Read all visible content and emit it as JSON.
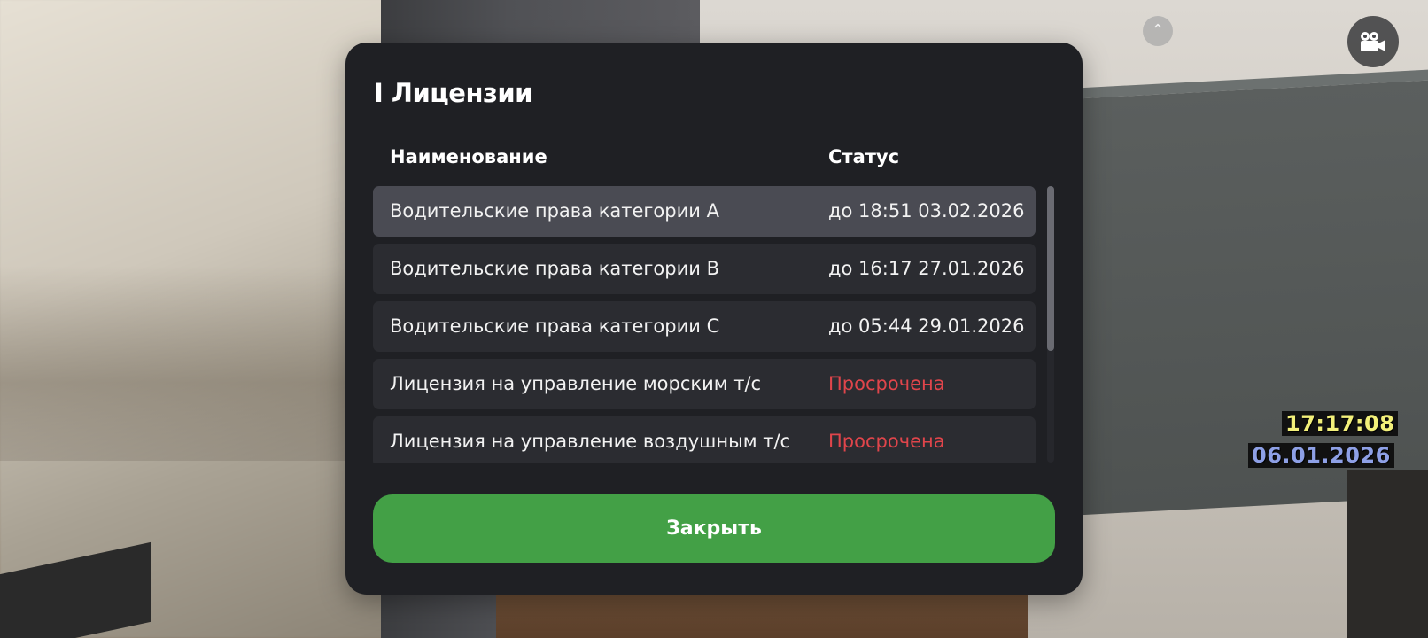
{
  "modal": {
    "title": "I Лицензии",
    "columns": {
      "name": "Наименование",
      "status": "Статус"
    },
    "rows": [
      {
        "name": "Водительские права категории A",
        "status": "до 18:51 03.02.2026",
        "expired": false
      },
      {
        "name": "Водительские права категории B",
        "status": "до 16:17 27.01.2026",
        "expired": false
      },
      {
        "name": "Водительские права категории C",
        "status": "до 05:44 29.01.2026",
        "expired": false
      },
      {
        "name": "Лицензия на управление морским т/с",
        "status": "Просрочена",
        "expired": true
      },
      {
        "name": "Лицензия на управление воздушным т/с",
        "status": "Просрочена",
        "expired": true
      }
    ],
    "close_label": "Закрыть"
  },
  "hud": {
    "time": "17:17:08",
    "date": "06.01.2026",
    "arrow_icon": "chevron-up-icon",
    "camera_icon": "video-camera-icon"
  },
  "colors": {
    "modal_bg": "#1f2024",
    "row_bg": "#2b2c31",
    "row_active_bg": "#4a4b53",
    "expired": "#e0454b",
    "close_button": "#43a046",
    "time_text": "#f3f07a",
    "date_text": "#8ea0e6"
  }
}
